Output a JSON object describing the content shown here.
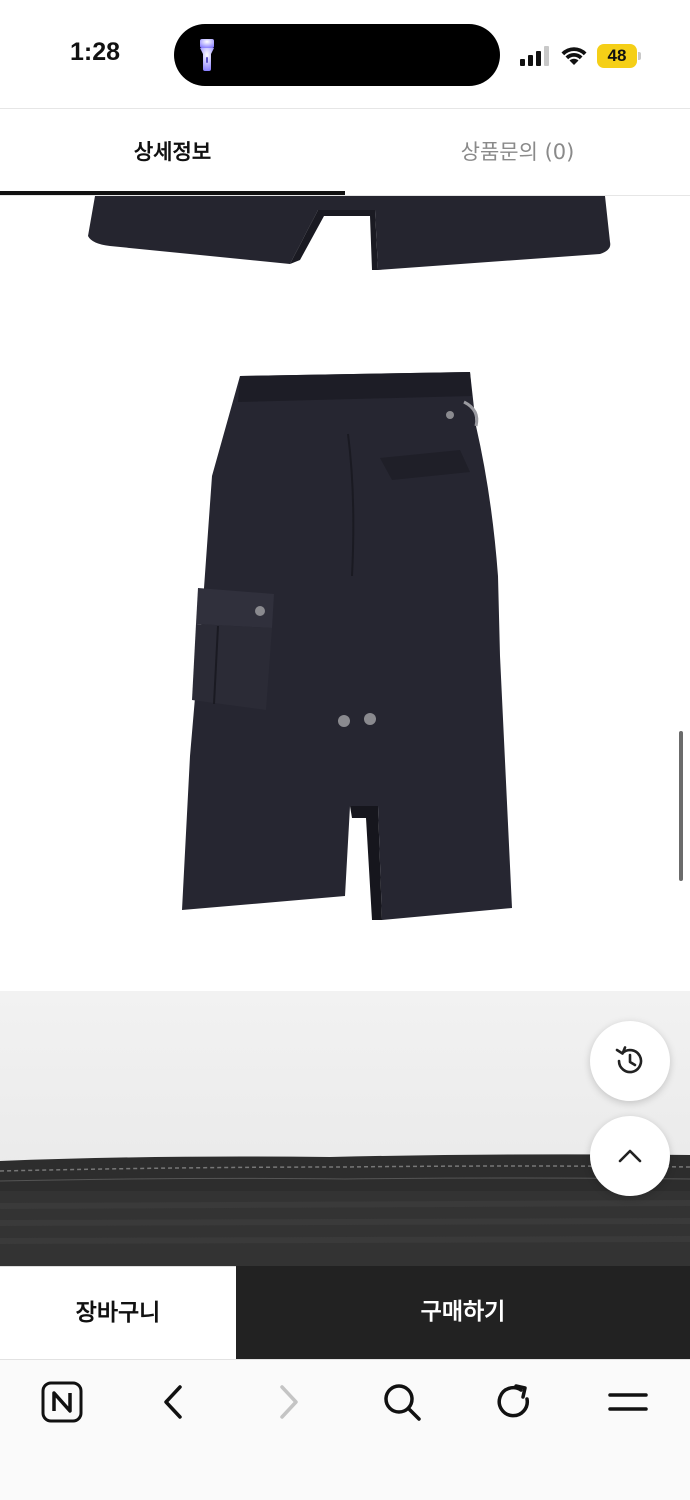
{
  "status_bar": {
    "time": "1:28",
    "battery_level": "48",
    "icons": [
      "flashlight-icon",
      "cellular-signal-icon",
      "wifi-icon",
      "battery-icon"
    ]
  },
  "tabs": [
    {
      "label": "상세정보",
      "active": true
    },
    {
      "label": "상품문의 (0)",
      "active": false
    }
  ],
  "content": {
    "images": [
      "skirt-product-photo",
      "fabric-detail-photo"
    ]
  },
  "floating": {
    "history_icon": "history-icon",
    "scroll_top_icon": "chevron-up-icon"
  },
  "purchase_bar": {
    "cart_label": "장바구니",
    "buy_label": "구매하기"
  },
  "browser_toolbar": {
    "icons": [
      "naver-home-icon",
      "back-icon",
      "forward-icon",
      "search-icon",
      "reload-icon",
      "menu-icon"
    ]
  },
  "colors": {
    "buy_button_bg": "#222222",
    "active_tab_text": "#111111",
    "inactive_tab_text": "#8a8a8a",
    "battery_bg": "#f5cf17"
  }
}
